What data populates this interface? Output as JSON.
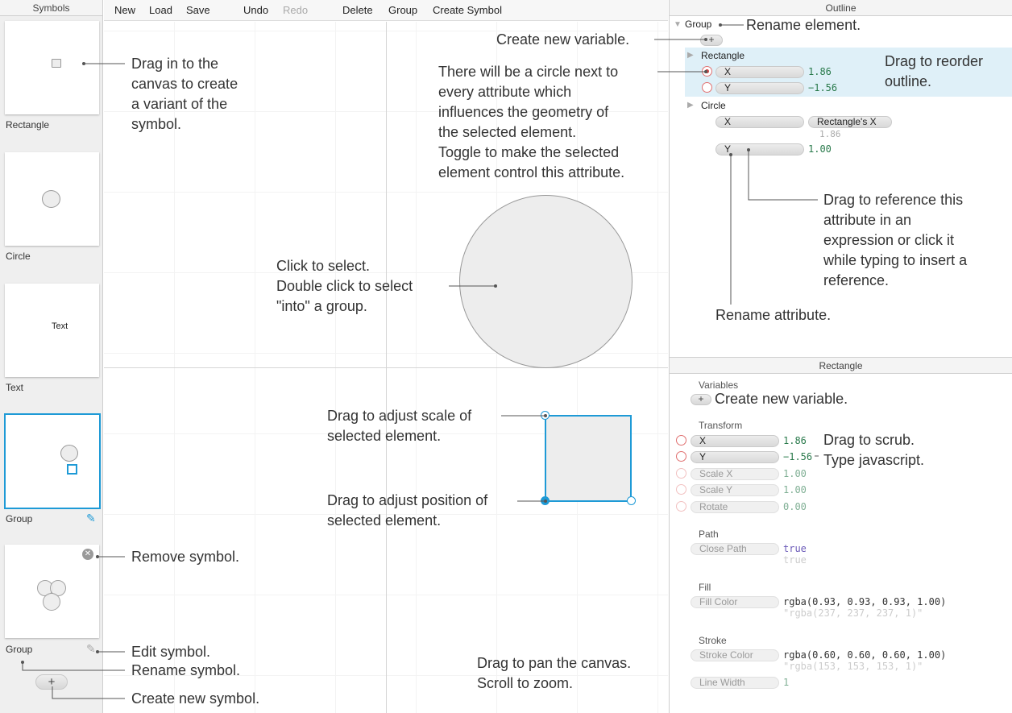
{
  "sidebar": {
    "title": "Symbols",
    "symbols": [
      {
        "label": "Rectangle"
      },
      {
        "label": "Circle"
      },
      {
        "label": "Text",
        "preview_text": "Text"
      },
      {
        "label": "Group"
      },
      {
        "label": "Group"
      }
    ],
    "add_button": "+"
  },
  "toolbar": {
    "new": "New",
    "load": "Load",
    "save": "Save",
    "undo": "Undo",
    "redo": "Redo",
    "delete": "Delete",
    "group": "Group",
    "create_symbol": "Create Symbol"
  },
  "outline": {
    "title": "Outline",
    "root": "Group",
    "add_variable": "+",
    "rectangle": {
      "name": "Rectangle",
      "x_label": "X",
      "x_value": "1.86",
      "y_label": "Y",
      "y_value": "−1.56"
    },
    "circle": {
      "name": "Circle",
      "x_label": "X",
      "x_ref": "Rectangle's X",
      "x_resolved": "1.86",
      "y_label": "Y",
      "y_value": "1.00"
    }
  },
  "inspector": {
    "title": "Rectangle",
    "variables_label": "Variables",
    "add_variable": "+",
    "transform_label": "Transform",
    "transform": [
      {
        "label": "X",
        "value": "1.86"
      },
      {
        "label": "Y",
        "value": "−1.56"
      },
      {
        "label": "Scale X",
        "value": "1.00"
      },
      {
        "label": "Scale Y",
        "value": "1.00"
      },
      {
        "label": "Rotate",
        "value": "0.00"
      }
    ],
    "path_label": "Path",
    "close_path": {
      "label": "Close Path",
      "value": "true",
      "resolved": "true"
    },
    "fill_label": "Fill",
    "fill_color": {
      "label": "Fill Color",
      "value": "rgba(0.93, 0.93, 0.93, 1.00)",
      "resolved": "\"rgba(237, 237, 237, 1)\""
    },
    "stroke_label": "Stroke",
    "stroke_color": {
      "label": "Stroke Color",
      "value": "rgba(0.60, 0.60, 0.60, 1.00)",
      "resolved": "\"rgba(153, 153, 153, 1)\""
    },
    "line_width": {
      "label": "Line Width",
      "value": "1"
    }
  },
  "annotations": {
    "drag_in": "Drag in to the\ncanvas to create\na variant of the\nsymbol.",
    "remove_symbol": "Remove symbol.",
    "edit_symbol": "Edit symbol.",
    "rename_symbol": "Rename symbol.",
    "create_symbol": "Create new symbol.",
    "click_select": "Click to select.\nDouble click to select\n\"into\" a group.",
    "adjust_scale": "Drag to adjust scale of\nselected element.",
    "adjust_position": "Drag to adjust position of\nselected element.",
    "pan_canvas": "Drag to pan the canvas.\nScroll to zoom.",
    "create_variable_top": "Create new variable.",
    "rename_element": "Rename element.",
    "circle_next": "There will be a circle next to\nevery attribute which\ninfluences the geometry of\nthe selected element.\nToggle to make the selected\nelement control this attribute.",
    "reorder": "Drag to reorder\noutline.",
    "reference": "Drag to reference this\nattribute in an\nexpression or click it\nwhile typing to insert a\nreference.",
    "rename_attribute": "Rename attribute.",
    "create_variable_insp": "Create new variable.",
    "scrub": "Drag to scrub.\nType javascript."
  },
  "colors": {
    "accent": "#1e9ad6",
    "highlight": "#dff0f8",
    "value_green": "#2a7a4c"
  }
}
